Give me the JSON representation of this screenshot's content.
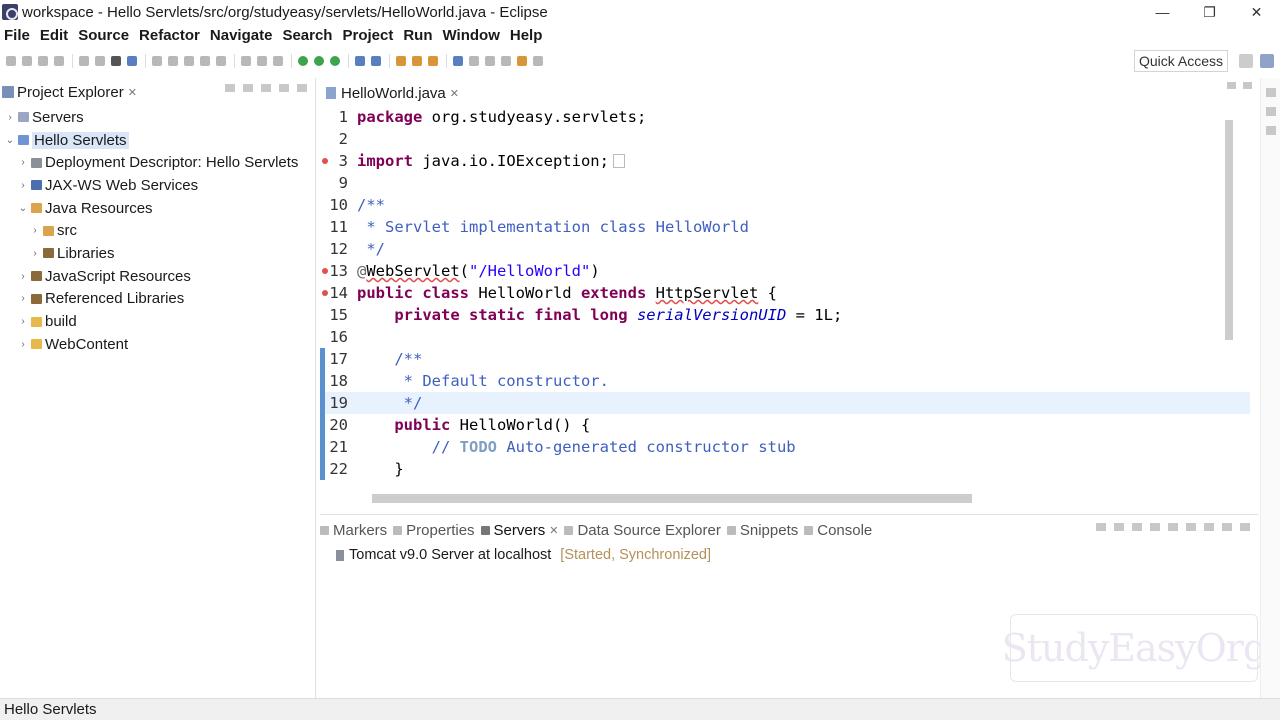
{
  "window": {
    "title": "workspace - Hello Servlets/src/org/studyeasy/servlets/HelloWorld.java - Eclipse",
    "controls": [
      "—",
      "❐",
      "✕"
    ]
  },
  "menu": [
    "File",
    "Edit",
    "Source",
    "Refactor",
    "Navigate",
    "Search",
    "Project",
    "Run",
    "Window",
    "Help"
  ],
  "toolbar": {
    "quick_access": "Quick Access"
  },
  "explorer": {
    "tab_label": "Project Explorer",
    "tab_close": "✕",
    "items": [
      {
        "label": "Servers",
        "arrow": "›",
        "icon": "server-folder-icon",
        "level": 0
      },
      {
        "label": "Hello Servlets",
        "arrow": "⌄",
        "icon": "project-icon",
        "level": 0,
        "selected": true
      },
      {
        "label": "Deployment Descriptor: Hello Servlets",
        "arrow": "›",
        "icon": "descriptor-icon",
        "level": 1
      },
      {
        "label": "JAX-WS Web Services",
        "arrow": "›",
        "icon": "webservice-icon",
        "level": 1
      },
      {
        "label": "Java Resources",
        "arrow": "⌄",
        "icon": "java-resources-icon",
        "level": 1
      },
      {
        "label": "src",
        "arrow": "›",
        "icon": "package-folder-icon",
        "level": 2
      },
      {
        "label": "Libraries",
        "arrow": "›",
        "icon": "library-icon",
        "level": 2
      },
      {
        "label": "JavaScript Resources",
        "arrow": "›",
        "icon": "js-resources-icon",
        "level": 1
      },
      {
        "label": "Referenced Libraries",
        "arrow": "›",
        "icon": "library-icon",
        "level": 1
      },
      {
        "label": "build",
        "arrow": "›",
        "icon": "folder-icon",
        "level": 1
      },
      {
        "label": "WebContent",
        "arrow": "›",
        "icon": "folder-icon",
        "level": 1
      }
    ]
  },
  "editor": {
    "tab_label": "HelloWorld.java",
    "tab_close": "✕",
    "lines": [
      {
        "n": "1",
        "text": "package org.studyeasy.servlets;"
      },
      {
        "n": "2",
        "text": ""
      },
      {
        "n": "3",
        "text": "import java.io.IOException;"
      },
      {
        "n": "9",
        "text": ""
      },
      {
        "n": "10",
        "text": "/**"
      },
      {
        "n": "11",
        "text": " * Servlet implementation class HelloWorld"
      },
      {
        "n": "12",
        "text": " */"
      },
      {
        "n": "13",
        "text": "@WebServlet(\"/HelloWorld\")"
      },
      {
        "n": "14",
        "text": "public class HelloWorld extends HttpServlet {"
      },
      {
        "n": "15",
        "text": "    private static final long serialVersionUID = 1L;"
      },
      {
        "n": "16",
        "text": ""
      },
      {
        "n": "17",
        "text": "    /**"
      },
      {
        "n": "18",
        "text": "     * Default constructor."
      },
      {
        "n": "19",
        "text": "     */"
      },
      {
        "n": "20",
        "text": "    public HelloWorld() {"
      },
      {
        "n": "21",
        "text": "        // TODO Auto-generated constructor stub"
      },
      {
        "n": "22",
        "text": "    }"
      }
    ]
  },
  "bottom_panel": {
    "tabs": [
      "Markers",
      "Properties",
      "Servers",
      "Data Source Explorer",
      "Snippets",
      "Console"
    ],
    "active_tab": "Servers",
    "tab_close": "✕",
    "server_name": "Tomcat v9.0 Server at localhost",
    "server_status": "[Started, Synchronized]"
  },
  "watermark": "StudyEasyOrg",
  "statusbar": {
    "text": "Hello Servlets"
  }
}
